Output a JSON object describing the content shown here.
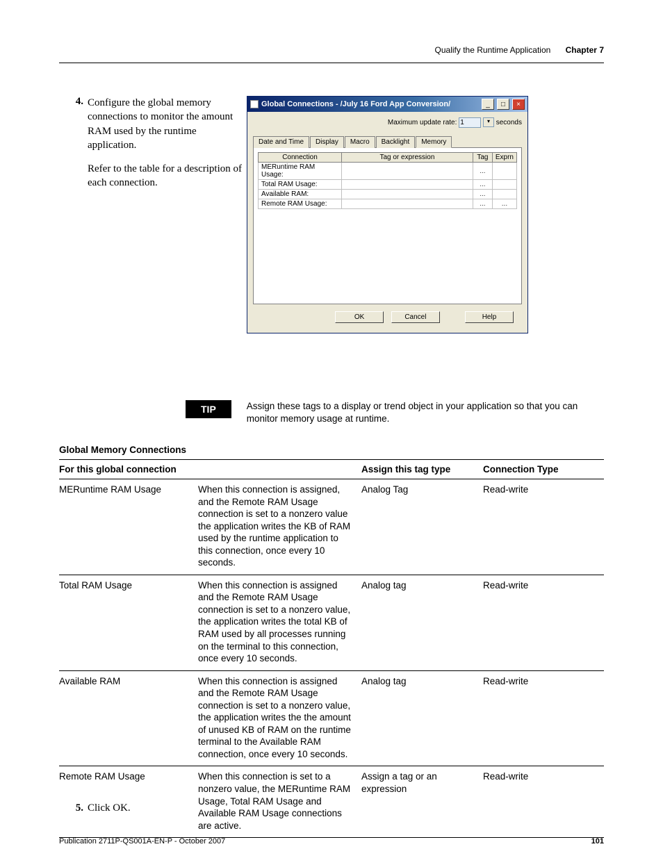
{
  "header": {
    "section": "Qualify the Runtime Application",
    "chapter": "Chapter 7"
  },
  "steps": {
    "four": {
      "num": "4.",
      "para1": "Configure the global memory connections to monitor the amount RAM used by the runtime application.",
      "para2": "Refer to the table for a description of each connection."
    },
    "five": {
      "num": "5.",
      "text": "Click OK."
    }
  },
  "dialog": {
    "title": "Global Connections - /July 16 Ford App Conversion/",
    "updateLabel": "Maximum update rate:",
    "updateValue": "1",
    "updateSuffix": "seconds",
    "tabs": [
      "Date and Time",
      "Display",
      "Macro",
      "Backlight",
      "Memory"
    ],
    "cols": {
      "conn": "Connection",
      "tag": "Tag or expression",
      "tagbtn": "Tag",
      "expr": "Exprn"
    },
    "rows": [
      {
        "c": "MERuntime RAM Usage:",
        "t": "",
        "tag": "...",
        "e": ""
      },
      {
        "c": "Total RAM Usage:",
        "t": "",
        "tag": "...",
        "e": ""
      },
      {
        "c": "Available RAM:",
        "t": "",
        "tag": "...",
        "e": ""
      },
      {
        "c": "Remote RAM Usage:",
        "t": "",
        "tag": "...",
        "e": "..."
      }
    ],
    "buttons": {
      "ok": "OK",
      "cancel": "Cancel",
      "help": "Help"
    }
  },
  "tip": {
    "label": "TIP",
    "text": "Assign these tags to a display or trend object in your application so that you can monitor memory usage at runtime."
  },
  "connTable": {
    "caption": "Global Memory Connections",
    "headers": {
      "c1": "For this global connection",
      "c2": "",
      "c3": "Assign this tag type",
      "c4": "Connection Type"
    },
    "rows": [
      {
        "c1": "MERuntime RAM Usage",
        "c2": "When this connection is assigned, and the Remote RAM Usage connection is set to a nonzero value the application writes the KB of RAM used by the runtime application to this connection, once every 10 seconds.",
        "c3": "Analog Tag",
        "c4": "Read-write"
      },
      {
        "c1": "Total RAM Usage",
        "c2": "When this connection is assigned and the Remote RAM Usage connection is set to a nonzero value, the application writes the total KB of RAM used by all processes running on the terminal to this connection, once every 10 seconds.",
        "c3": "Analog tag",
        "c4": "Read-write"
      },
      {
        "c1": "Available RAM",
        "c2": "When this connection is assigned and the Remote RAM Usage connection is set to a nonzero value, the application writes the the amount of unused KB of RAM on the runtime terminal to the Available RAM connection, once every 10 seconds.",
        "c3": "Analog tag",
        "c4": "Read-write"
      },
      {
        "c1": "Remote RAM Usage",
        "c2": "When this connection is set to a nonzero value, the MERuntime RAM Usage, Total RAM Usage and Available RAM Usage connections are active.",
        "c3": "Assign a tag or an expression",
        "c4": "Read-write"
      }
    ]
  },
  "footer": {
    "pub": "Publication 2711P-QS001A-EN-P - October 2007",
    "page": "101"
  }
}
